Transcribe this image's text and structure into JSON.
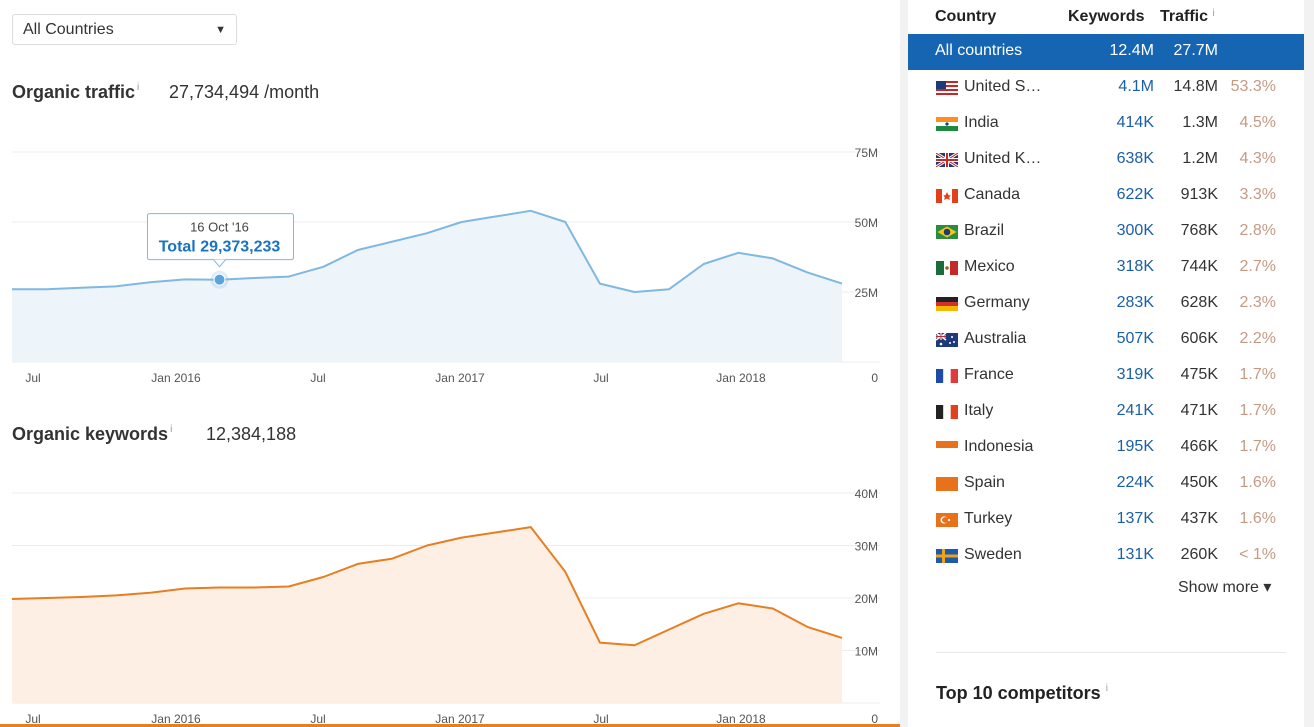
{
  "filter": {
    "selected": "All Countries"
  },
  "traffic": {
    "title": "Organic traffic",
    "info": "i",
    "value": "27,734,494 /month",
    "tooltip": {
      "date": "16 Oct '16",
      "total": "Total 29,373,233"
    },
    "y_ticks": [
      "75M",
      "50M",
      "25M",
      "0"
    ],
    "x_ticks": [
      "Jul",
      "Jan 2016",
      "Jul",
      "Jan 2017",
      "Jul",
      "Jan 2018"
    ],
    "color": "#7fb8e0",
    "fill": "#edf5fb"
  },
  "keywords": {
    "title": "Organic keywords",
    "info": "i",
    "value": "12,384,188",
    "y_ticks": [
      "40M",
      "30M",
      "20M",
      "10M",
      "0"
    ],
    "x_ticks": [
      "Jul",
      "Jan 2016",
      "Jul",
      "Jan 2017",
      "Jul",
      "Jan 2018"
    ],
    "color": "#e67e22",
    "fill": "#fdefe3"
  },
  "chart_data": [
    {
      "type": "area",
      "title": "Organic traffic",
      "x": [
        "2015-06",
        "2015-09",
        "2015-12",
        "2016-03",
        "2016-06",
        "2016-08",
        "2016-10",
        "2016-12",
        "2017-01",
        "2017-02",
        "2017-03",
        "2017-04",
        "2017-05",
        "2017-06",
        "2017-07",
        "2017-08",
        "2017-09",
        "2017-10",
        "2017-11",
        "2017-12",
        "2018-01",
        "2018-02",
        "2018-03",
        "2018-04",
        "2018-05"
      ],
      "values": [
        26,
        26,
        26.5,
        27,
        28.5,
        29.5,
        29.4,
        30,
        30.5,
        34,
        40,
        43,
        46,
        50,
        52,
        54,
        50,
        28,
        25,
        26,
        35,
        39,
        37,
        32,
        28
      ],
      "ylim": [
        0,
        75
      ],
      "unit": "M"
    },
    {
      "type": "area",
      "title": "Organic keywords",
      "x": [
        "2015-06",
        "2015-09",
        "2015-12",
        "2016-03",
        "2016-06",
        "2016-08",
        "2016-10",
        "2016-12",
        "2017-01",
        "2017-02",
        "2017-03",
        "2017-04",
        "2017-05",
        "2017-06",
        "2017-07",
        "2017-08",
        "2017-09",
        "2017-10",
        "2017-11",
        "2017-12",
        "2018-01",
        "2018-02",
        "2018-03",
        "2018-04",
        "2018-05"
      ],
      "values": [
        19.8,
        20,
        20.2,
        20.5,
        21,
        21.8,
        22,
        22,
        22.2,
        24,
        26.5,
        27.5,
        30,
        31.5,
        32.5,
        33.5,
        25,
        11.5,
        11,
        14,
        17,
        19,
        18,
        14.5,
        12.4
      ],
      "ylim": [
        0,
        40
      ],
      "unit": "M"
    }
  ],
  "table": {
    "headers": {
      "country": "Country",
      "keywords": "Keywords",
      "traffic": "Traffic",
      "info": "i"
    },
    "all": {
      "name": "All countries",
      "keywords": "12.4M",
      "traffic": "27.7M"
    },
    "rows": [
      {
        "name": "United S…",
        "flag": "us-flag",
        "keywords": "4.1M",
        "traffic": "14.8M",
        "share": "53.3%"
      },
      {
        "name": "India",
        "flag": "india-flag",
        "keywords": "414K",
        "traffic": "1.3M",
        "share": "4.5%"
      },
      {
        "name": "United K…",
        "flag": "uk-flag",
        "keywords": "638K",
        "traffic": "1.2M",
        "share": "4.3%"
      },
      {
        "name": "Canada",
        "flag": "canada-flag",
        "keywords": "622K",
        "traffic": "913K",
        "share": "3.3%"
      },
      {
        "name": "Brazil",
        "flag": "brazil-flag",
        "keywords": "300K",
        "traffic": "768K",
        "share": "2.8%"
      },
      {
        "name": "Mexico",
        "flag": "mexico-flag",
        "keywords": "318K",
        "traffic": "744K",
        "share": "2.7%"
      },
      {
        "name": "Germany",
        "flag": "germany-flag",
        "keywords": "283K",
        "traffic": "628K",
        "share": "2.3%"
      },
      {
        "name": "Australia",
        "flag": "australia-flag",
        "keywords": "507K",
        "traffic": "606K",
        "share": "2.2%"
      },
      {
        "name": "France",
        "flag": "france-flag",
        "keywords": "319K",
        "traffic": "475K",
        "share": "1.7%"
      },
      {
        "name": "Italy",
        "flag": "italy-flag",
        "keywords": "241K",
        "traffic": "471K",
        "share": "1.7%"
      },
      {
        "name": "Indonesia",
        "flag": "indonesia-flag",
        "keywords": "195K",
        "traffic": "466K",
        "share": "1.7%"
      },
      {
        "name": "Spain",
        "flag": "spain-flag",
        "keywords": "224K",
        "traffic": "450K",
        "share": "1.6%"
      },
      {
        "name": "Turkey",
        "flag": "turkey-flag",
        "keywords": "137K",
        "traffic": "437K",
        "share": "1.6%"
      },
      {
        "name": "Sweden",
        "flag": "sweden-flag",
        "keywords": "131K",
        "traffic": "260K",
        "share": "< 1%"
      }
    ],
    "show_more": "Show more ▾"
  },
  "competitors": {
    "title": "Top 10 competitors",
    "info": "i"
  }
}
